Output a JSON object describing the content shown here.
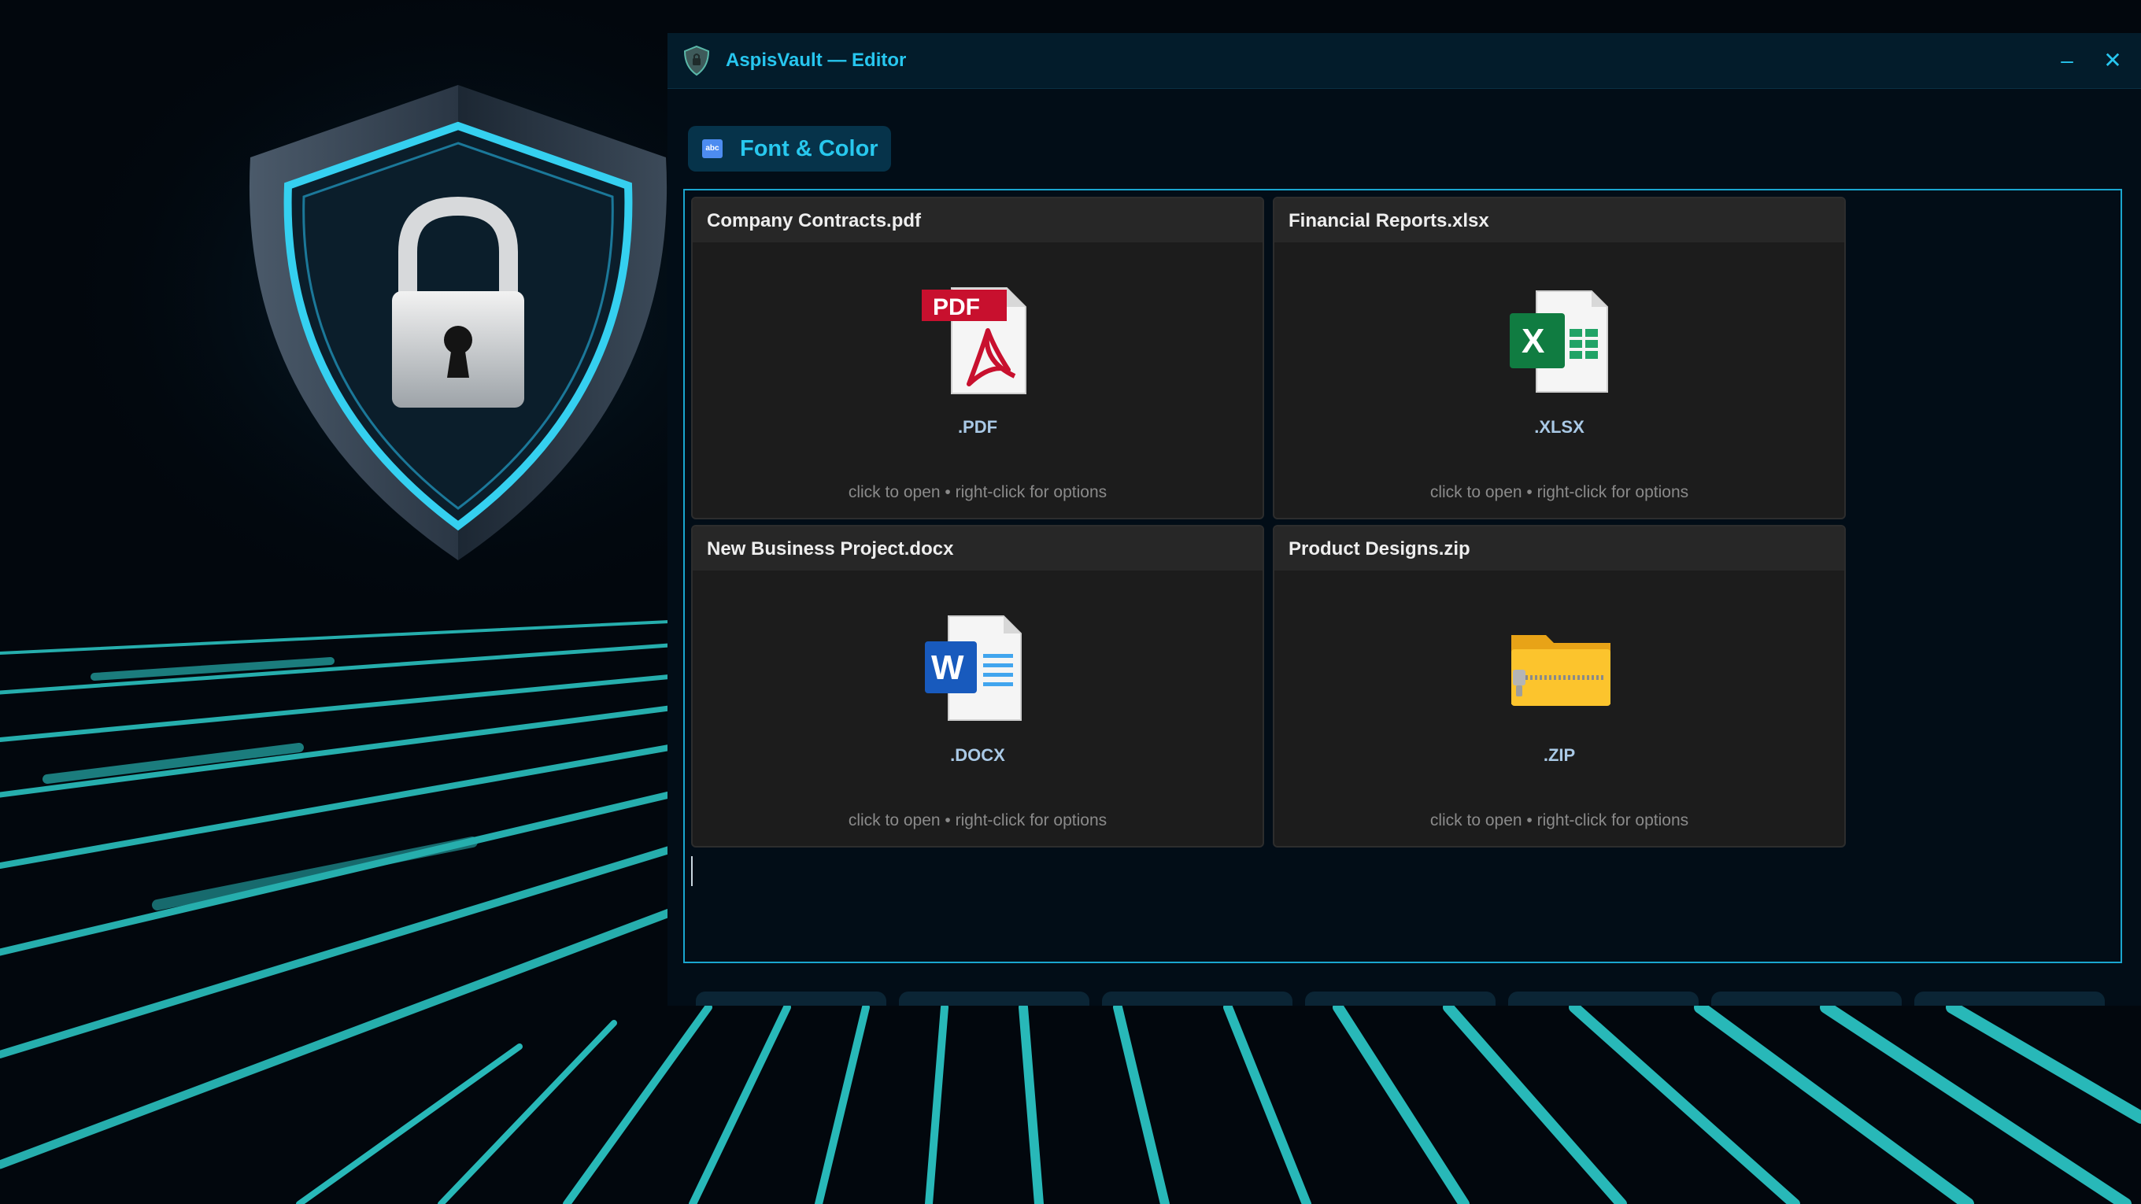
{
  "window": {
    "title": "AspisVault — Editor",
    "minimize_label": "–",
    "close_label": "✕"
  },
  "toolbar": {
    "tab_label": "Font & Color",
    "tab_icon_text": "abc"
  },
  "files": [
    {
      "name": "Company Contracts.pdf",
      "ext": ".PDF",
      "icon": "pdf-file-icon",
      "hint": "click to open  •  right-click for options"
    },
    {
      "name": "Financial Reports.xlsx",
      "ext": ".XLSX",
      "icon": "excel-file-icon",
      "hint": "click to open  •  right-click for options"
    },
    {
      "name": "New Business Project.docx",
      "ext": ".DOCX",
      "icon": "word-file-icon",
      "hint": "click to open  •  right-click for options"
    },
    {
      "name": "Product Designs.zip",
      "ext": ".ZIP",
      "icon": "zip-folder-icon",
      "hint": "click to open  •  right-click for options"
    }
  ],
  "icon_text": {
    "pdf": "PDF",
    "xlsx": "X",
    "docx": "W"
  },
  "colors": {
    "accent": "#27c6ef",
    "window_bg": "#020d17",
    "card_bg": "#1c1c1c",
    "neon": "#2ee6e0"
  }
}
